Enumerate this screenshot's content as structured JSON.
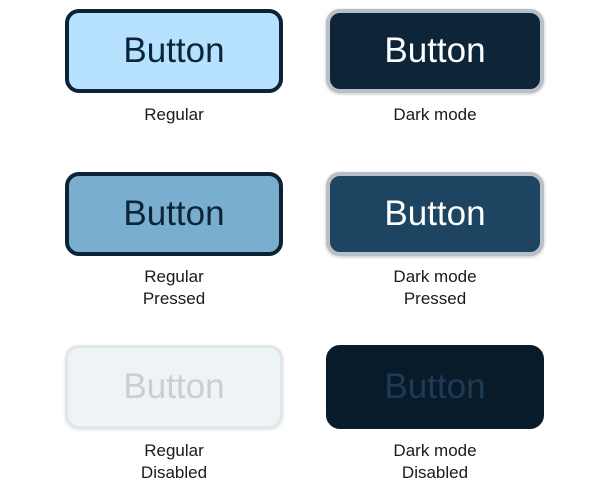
{
  "buttons": {
    "regular": {
      "label": "Button",
      "caption_line1": "Regular"
    },
    "dark_mode": {
      "label": "Button",
      "caption_line1": "Dark mode"
    },
    "regular_pressed": {
      "label": "Button",
      "caption_line1": "Regular",
      "caption_line2": "Pressed"
    },
    "dark_mode_pressed": {
      "label": "Button",
      "caption_line1": "Dark mode",
      "caption_line2": "Pressed"
    },
    "regular_disabled": {
      "label": "Button",
      "caption_line1": "Regular",
      "caption_line2": "Disabled"
    },
    "dark_mode_disabled": {
      "label": "Button",
      "caption_line1": "Dark mode",
      "caption_line2": "Disabled"
    }
  },
  "colors": {
    "regular_bg": "#b6e2ff",
    "regular_pressed_bg": "#79aecf",
    "regular_disabled_bg": "#eef3f6",
    "dark_bg": "#0d2439",
    "dark_pressed_bg": "#1d4562",
    "dark_disabled_bg": "#071b2b",
    "regular_border": "#0c2236",
    "dark_border": "#b9bfc6"
  }
}
